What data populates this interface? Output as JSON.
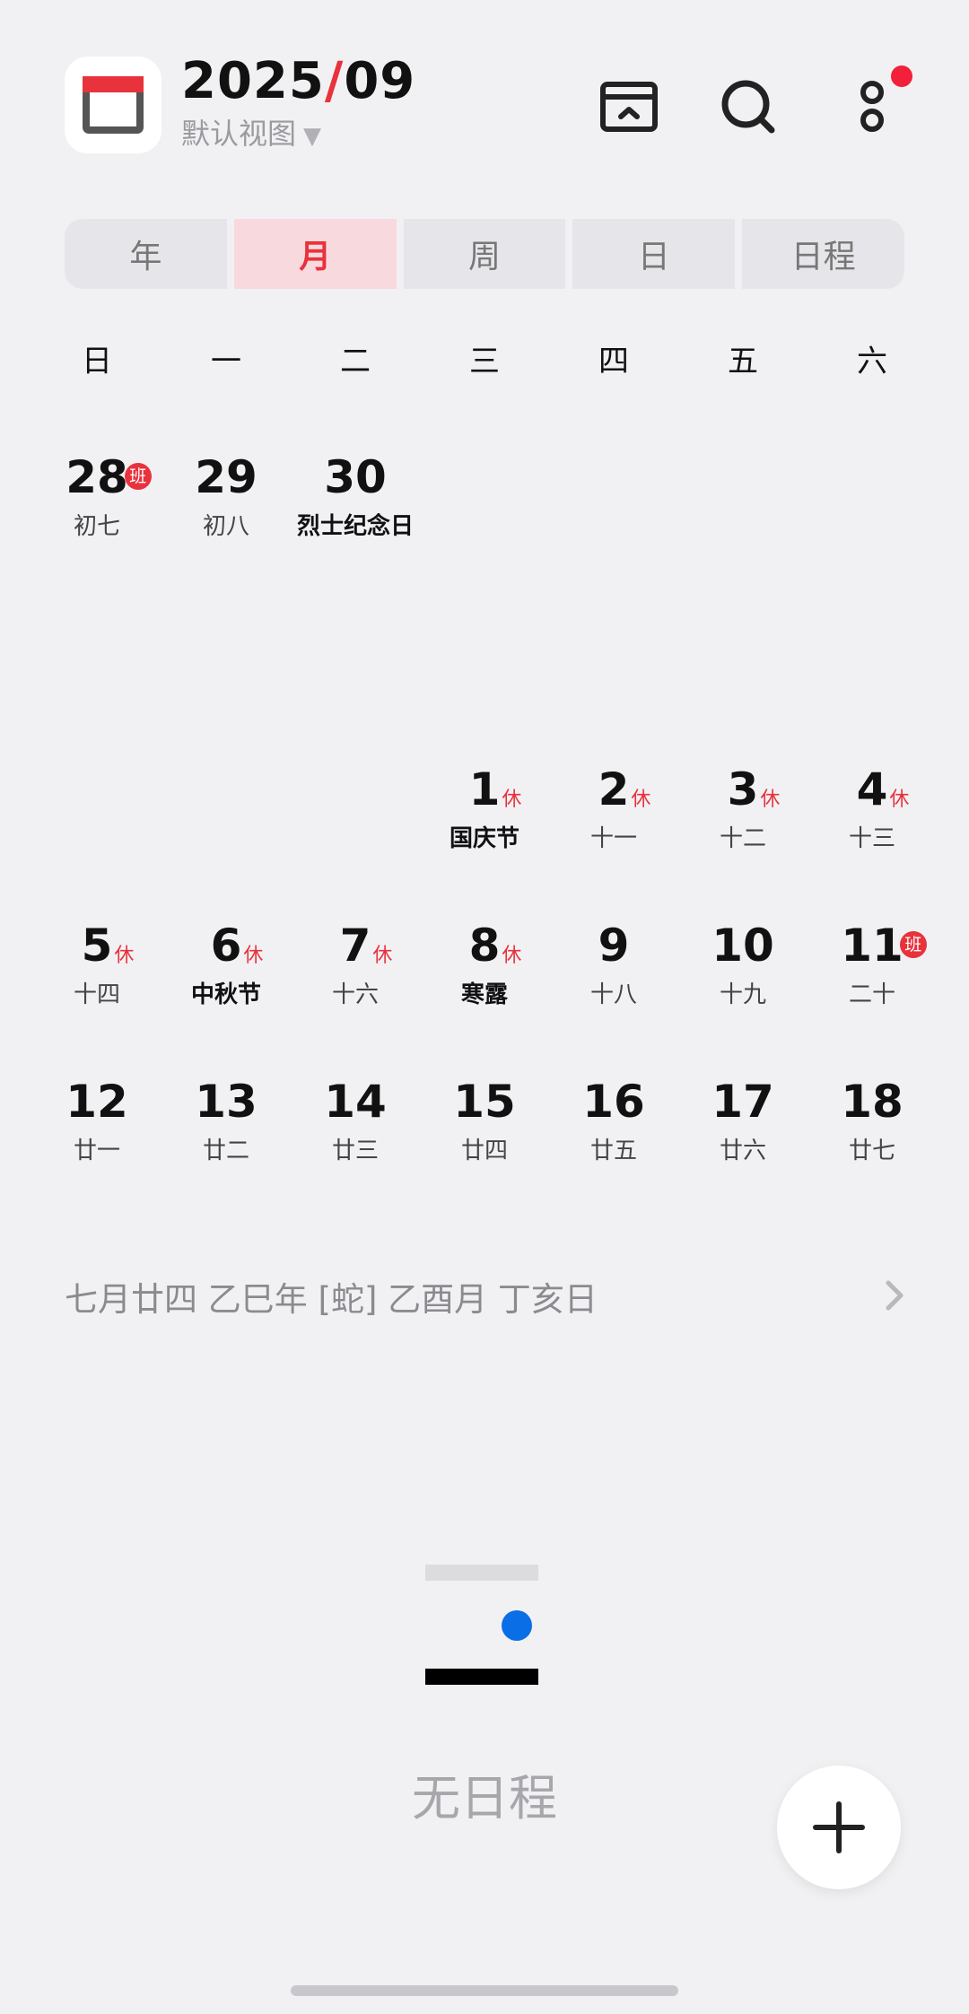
{
  "header": {
    "year": "2025",
    "separator": "/",
    "month": "09",
    "view_label": "默认视图",
    "icons": [
      "calendar-app-icon",
      "archive-icon",
      "search-icon",
      "more-icon"
    ],
    "accent_color": "#e8323c"
  },
  "tabs": [
    {
      "label": "年",
      "active": false
    },
    {
      "label": "月",
      "active": true
    },
    {
      "label": "周",
      "active": false
    },
    {
      "label": "日",
      "active": false
    },
    {
      "label": "日程",
      "active": false
    }
  ],
  "weekdays": [
    "日",
    "一",
    "二",
    "三",
    "四",
    "五",
    "六"
  ],
  "calendar": {
    "rows": [
      [
        {
          "day": "28",
          "sub": "初七",
          "tag": "班"
        },
        {
          "day": "29",
          "sub": "初八"
        },
        {
          "day": "30",
          "sub": "烈士纪念日",
          "festival": true
        }
      ],
      [
        {
          "day": "1",
          "sub": "国庆节",
          "tag": "休",
          "festival": true
        },
        {
          "day": "2",
          "sub": "十一",
          "tag": "休"
        },
        {
          "day": "3",
          "sub": "十二",
          "tag": "休"
        },
        {
          "day": "4",
          "sub": "十三",
          "tag": "休"
        }
      ],
      [
        {
          "day": "5",
          "sub": "十四",
          "tag": "休"
        },
        {
          "day": "6",
          "sub": "中秋节",
          "tag": "休",
          "festival": true
        },
        {
          "day": "7",
          "sub": "十六",
          "tag": "休"
        },
        {
          "day": "8",
          "sub": "寒露",
          "tag": "休",
          "festival": true
        },
        {
          "day": "9",
          "sub": "十八"
        },
        {
          "day": "10",
          "sub": "十九"
        },
        {
          "day": "11",
          "sub": "二十",
          "tag": "班"
        }
      ],
      [
        {
          "day": "12",
          "sub": "廿一"
        },
        {
          "day": "13",
          "sub": "廿二"
        },
        {
          "day": "14",
          "sub": "廿三"
        },
        {
          "day": "15",
          "sub": "廿四"
        },
        {
          "day": "16",
          "sub": "廿五"
        },
        {
          "day": "17",
          "sub": "廿六"
        },
        {
          "day": "18",
          "sub": "廿七"
        }
      ]
    ]
  },
  "lunar_info": "七月廿四   乙巳年 [蛇] 乙酉月 丁亥日",
  "empty_state": {
    "text": "无日程"
  }
}
